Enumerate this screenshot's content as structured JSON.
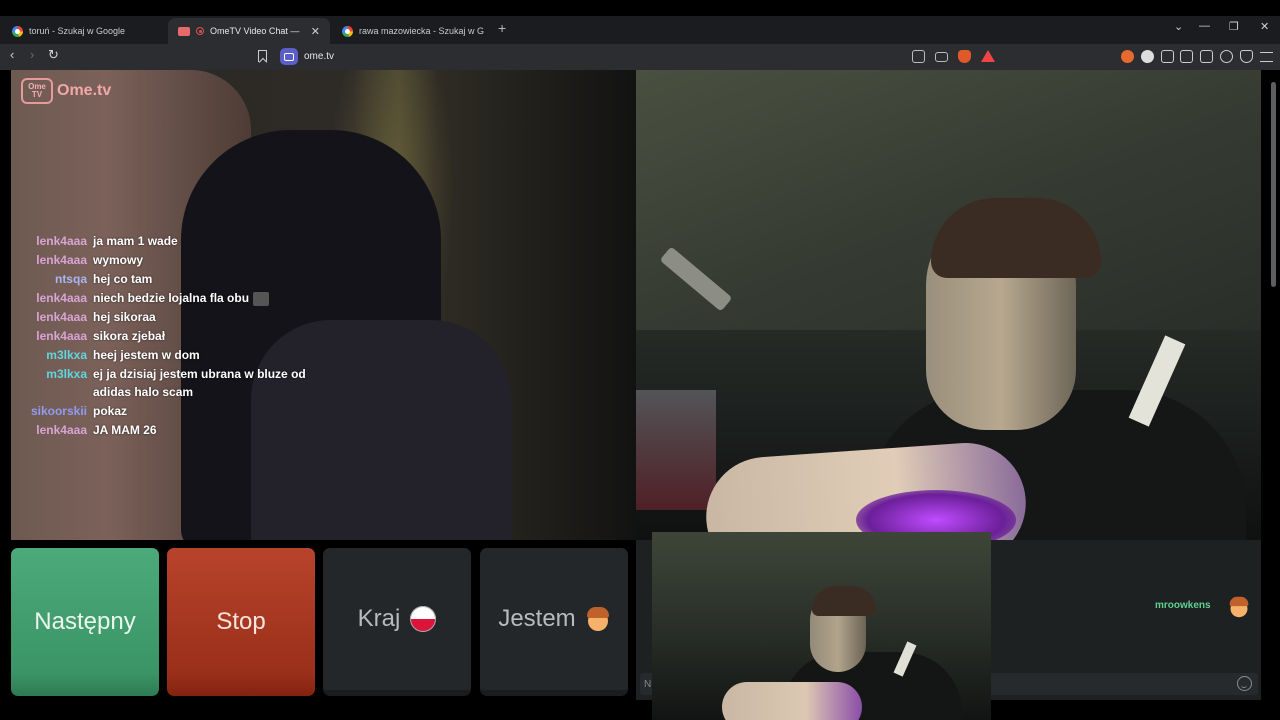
{
  "browser": {
    "tabs": [
      {
        "label": "toruń - Szukaj w Google",
        "icon": "google-icon"
      },
      {
        "label": "OmeTV Video Chat — Omegle",
        "icon": "ometv-favicon",
        "active": true,
        "close": "✕"
      },
      {
        "label": "rawa mazowiecka - Szukaj w Google",
        "icon": "google-icon"
      }
    ],
    "new_tab": "+",
    "window_controls": {
      "dropdown": "⌄",
      "minimize": "—",
      "restore": "❐",
      "close": "✕"
    },
    "nav": {
      "back": "‹",
      "forward": "›",
      "reload": "↻"
    },
    "url": "ome.tv"
  },
  "app": {
    "logo_box": "Ome TV",
    "logo_text": "Ome.tv",
    "chat_messages": [
      {
        "nick": "lenk4aaa",
        "text": "ja mam 1 wade",
        "color": "#d7a4d4"
      },
      {
        "nick": "lenk4aaa",
        "text": "wymowy",
        "color": "#d7a4d4"
      },
      {
        "nick": "ntsqa",
        "text": "hej co tam",
        "color": "#a9b4f0"
      },
      {
        "nick": "lenk4aaa",
        "text": "niech bedzie lojalna fla obu",
        "color": "#d7a4d4",
        "emoji": true
      },
      {
        "nick": "lenk4aaa",
        "text": "hej sikoraa",
        "color": "#d7a4d4"
      },
      {
        "nick": "lenk4aaa",
        "text": "sikora zjebał",
        "color": "#d7a4d4"
      },
      {
        "nick": "m3lkxa",
        "text": "heej jestem w dom",
        "color": "#5fd6e0"
      },
      {
        "nick": "m3lkxa",
        "text": "ej ja dzisiaj jestem ubrana w bluze od adidas halo scam",
        "color": "#5fd6e0"
      },
      {
        "nick": "sikoorskii",
        "text": "pokaz",
        "color": "#8f9cf2"
      },
      {
        "nick": "lenk4aaa",
        "text": "JA MAM 26",
        "color": "#d7a4d4"
      }
    ],
    "buttons": {
      "next": "Następny",
      "stop": "Stop",
      "country": "Kraj",
      "gender": "Jestem"
    },
    "right_chat": {
      "nick": "mroowkens",
      "input_prefix": "N"
    }
  }
}
